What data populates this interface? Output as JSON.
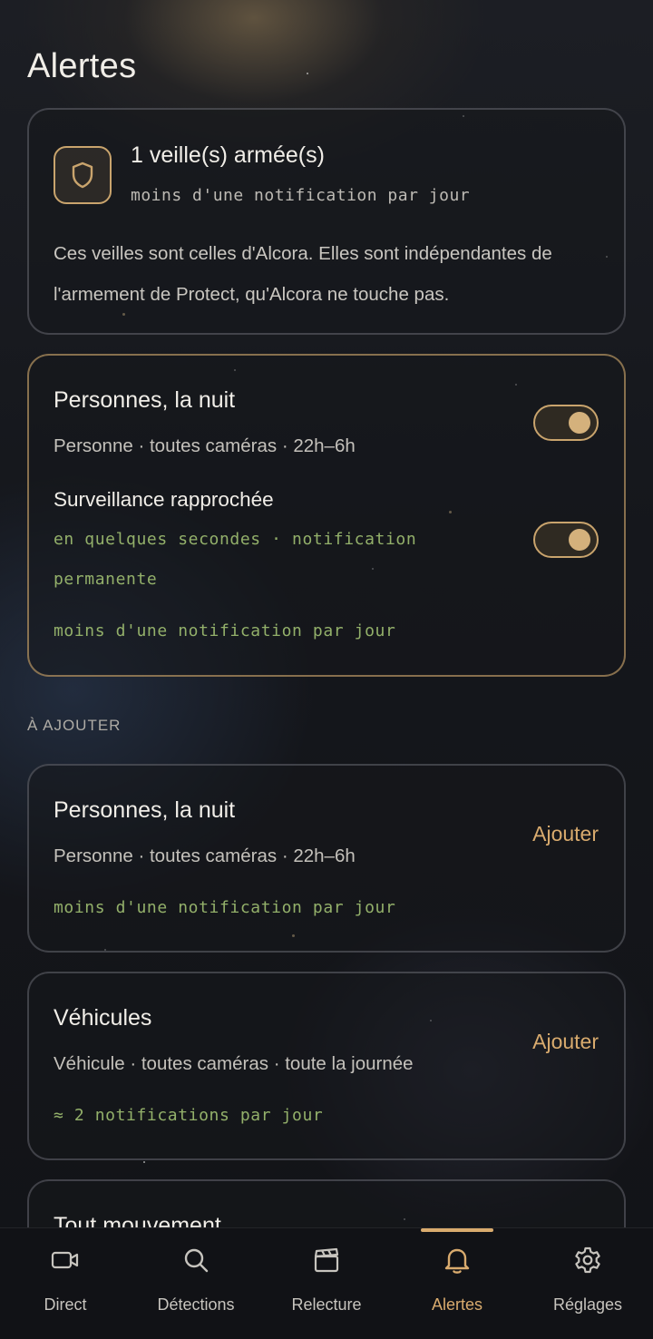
{
  "page": {
    "title": "Alertes"
  },
  "armed": {
    "title": "1 veille(s) armée(s)",
    "frequency": "moins d'une notification par jour",
    "description": "Ces veilles sont celles d'Alcora. Elles sont indépendantes de l'armement de Protect, qu'Alcora ne touche pas."
  },
  "active_rules": {
    "rule1": {
      "title": "Personnes, la nuit",
      "meta": "Personne · toutes caméras · 22h–6h",
      "enabled": true
    },
    "rule2": {
      "title": "Surveillance rapprochée",
      "detail_line1": "en quelques secondes · notification",
      "detail_line2": "permanente",
      "frequency": "moins d'une notification par jour",
      "enabled": true
    }
  },
  "to_add": {
    "label": "À AJOUTER",
    "items": [
      {
        "title": "Personnes, la nuit",
        "meta": "Personne · toutes caméras · 22h–6h",
        "frequency": "moins d'une notification par jour",
        "button": "Ajouter"
      },
      {
        "title": "Véhicules",
        "meta": "Véhicule · toutes caméras · toute la journée",
        "frequency": "≈ 2 notifications par jour",
        "button": "Ajouter"
      },
      {
        "title": "Tout mouvement"
      }
    ]
  },
  "nav": {
    "items": [
      {
        "label": "Direct",
        "icon": "camera-icon"
      },
      {
        "label": "Détections",
        "icon": "search-icon"
      },
      {
        "label": "Relecture",
        "icon": "clapperboard-icon"
      },
      {
        "label": "Alertes",
        "icon": "bell-icon",
        "active": true
      },
      {
        "label": "Réglages",
        "icon": "gear-icon"
      }
    ]
  },
  "colors": {
    "accent": "#d9ab6e",
    "green": "#93b06a",
    "background": "#15171c"
  }
}
